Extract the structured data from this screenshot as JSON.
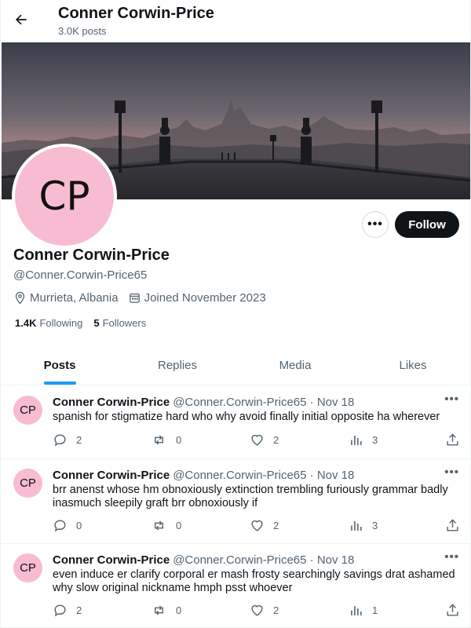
{
  "header": {
    "name": "Conner Corwin-Price",
    "post_count": "3.0K posts"
  },
  "profile": {
    "avatar_initials": "CP",
    "name": "Conner Corwin-Price",
    "handle": "@Conner.Corwin-Price65",
    "location": "Murrieta, Albania",
    "joined": "Joined November 2023",
    "following_count": "1.4K",
    "following_label": "Following",
    "followers_count": "5",
    "followers_label": "Followers",
    "more_label": "•••",
    "follow_label": "Follow"
  },
  "tabs": [
    {
      "label": "Posts"
    },
    {
      "label": "Replies"
    },
    {
      "label": "Media"
    },
    {
      "label": "Likes"
    }
  ],
  "posts": [
    {
      "avatar": "CP",
      "name": "Conner Corwin-Price",
      "meta": "@Conner.Corwin-Price65 · Nov 18",
      "text": "spanish for stigmatize hard who why avoid finally initial opposite ha wherever",
      "replies": "2",
      "reposts": "0",
      "likes": "2",
      "views": "3",
      "more": "•••"
    },
    {
      "avatar": "CP",
      "name": "Conner Corwin-Price",
      "meta": "@Conner.Corwin-Price65 · Nov 18",
      "text": "brr anenst whose hm obnoxiously extinction trembling furiously grammar badly inasmuch sleepily graft brr obnoxiously if",
      "replies": "0",
      "reposts": "0",
      "likes": "2",
      "views": "3",
      "more": "•••"
    },
    {
      "avatar": "CP",
      "name": "Conner Corwin-Price",
      "meta": "@Conner.Corwin-Price65 · Nov 18",
      "text": "even induce er clarify corporal er mash frosty searchingly savings drat ashamed why slow original nickname hmph psst whoever",
      "replies": "2",
      "reposts": "0",
      "likes": "2",
      "views": "1",
      "more": "•••"
    }
  ],
  "icons": {
    "back": "arrow-left-icon",
    "location": "location-pin-icon",
    "calendar": "calendar-icon",
    "reply": "reply-icon",
    "repost": "repost-icon",
    "like": "heart-icon",
    "views": "bar-chart-icon",
    "share": "share-icon"
  },
  "colors": {
    "accent": "#1d9bf0",
    "avatar_bg": "#f7bcd2",
    "follow_bg": "#0f1419",
    "muted": "#536471"
  }
}
